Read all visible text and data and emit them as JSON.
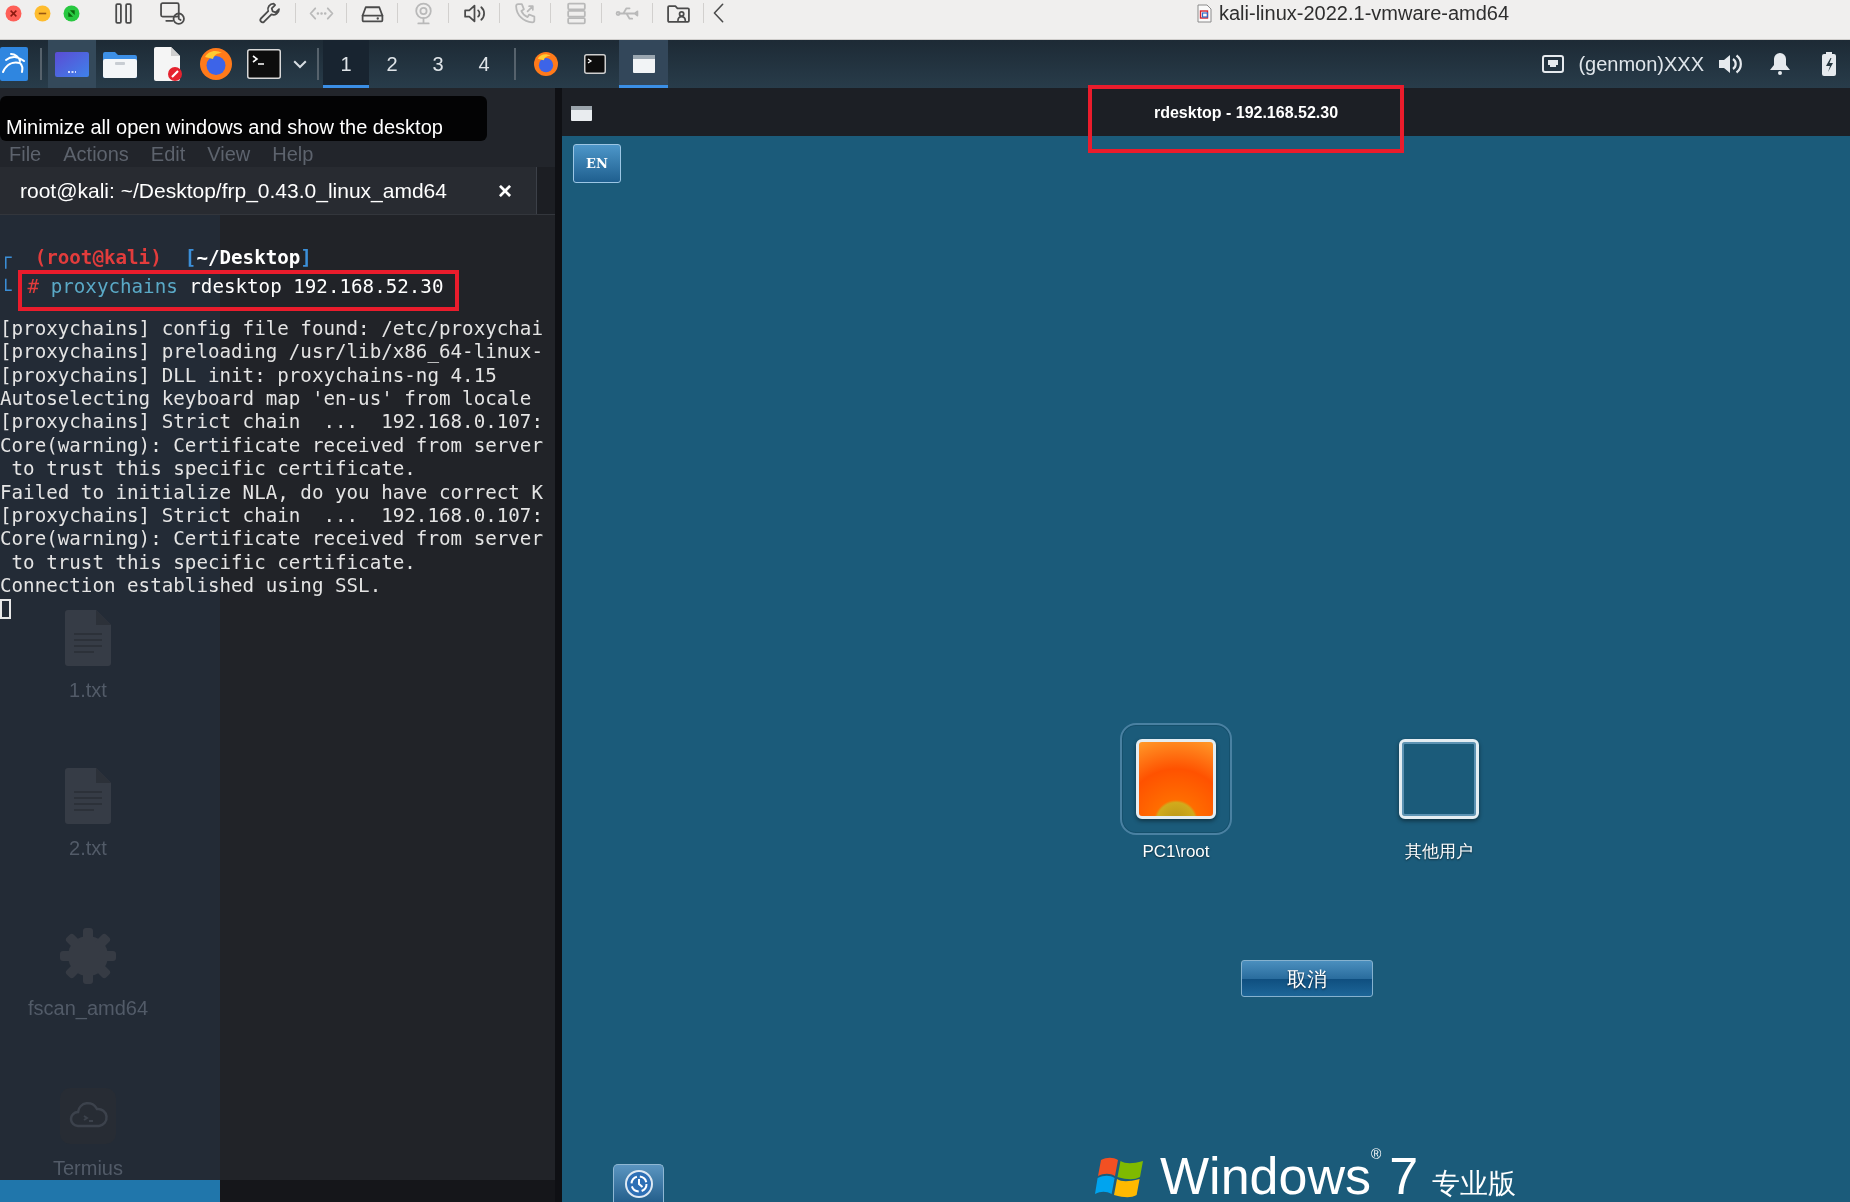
{
  "host_window": {
    "title": "kali-linux-2022.1-vmware-amd64",
    "toolbar": [
      {
        "kind": "pause",
        "disabled": false
      },
      {
        "kind": "snapshot",
        "disabled": false
      },
      {
        "kind": "settings",
        "disabled": false
      },
      {
        "kind": "network",
        "disabled": true
      },
      {
        "kind": "disk",
        "disabled": false
      },
      {
        "kind": "camera",
        "disabled": true
      },
      {
        "kind": "sound",
        "disabled": false
      },
      {
        "kind": "phone",
        "disabled": true
      },
      {
        "kind": "storage",
        "disabled": true
      },
      {
        "kind": "usb",
        "disabled": true
      },
      {
        "kind": "shared-folder",
        "disabled": false
      },
      {
        "kind": "collapse",
        "disabled": false
      }
    ]
  },
  "panel": {
    "launchers": [
      {
        "kind": "kali-menu",
        "hovered": false
      },
      {
        "kind": "show-desktop",
        "hovered": true
      },
      {
        "kind": "file-manager",
        "hovered": false
      },
      {
        "kind": "text-editor",
        "hovered": false
      },
      {
        "kind": "browser",
        "hovered": false
      },
      {
        "kind": "terminal",
        "hovered": false
      },
      {
        "kind": "dropdown",
        "hovered": false
      }
    ],
    "workspaces": [
      {
        "label": "1",
        "selected": true
      },
      {
        "label": "2",
        "selected": false
      },
      {
        "label": "3",
        "selected": false
      },
      {
        "label": "4",
        "selected": false
      }
    ],
    "tasks": [
      {
        "kind": "browser",
        "selected": false
      },
      {
        "kind": "terminal",
        "selected": false
      },
      {
        "kind": "window",
        "selected": true
      }
    ],
    "tray": [
      {
        "kind": "network"
      },
      {
        "kind": "text",
        "label": "(genmon)XXX"
      },
      {
        "kind": "volume"
      },
      {
        "kind": "notifications"
      },
      {
        "kind": "battery"
      }
    ]
  },
  "tooltip": {
    "text": "Minimize all open windows and show the desktop"
  },
  "desktop_icons": [
    {
      "kind": "text-file",
      "label": "1.txt"
    },
    {
      "kind": "text-file",
      "label": "2.txt"
    },
    {
      "kind": "executable",
      "label": "fscan_amd64"
    },
    {
      "kind": "app",
      "label": "Termius"
    }
  ],
  "terminal": {
    "menu": [
      "File",
      "Actions",
      "Edit",
      "View",
      "Help"
    ],
    "tab": {
      "title": "root@kali: ~/Desktop/frp_0.43.0_linux_amd64",
      "close": "×"
    },
    "prompt": {
      "corner": "┌",
      "user": "(root@kali)",
      "dir": "[**~/Desktop**]"
    },
    "command": {
      "corner": "└",
      "symbol": "#",
      "program": "proxychains",
      "args": "rdesktop 192.168.52.30",
      "highlighted": true
    },
    "output": [
      "[proxychains] config file found: /etc/proxychai",
      "[proxychains] preloading /usr/lib/x86_64-linux-",
      "[proxychains] DLL init: proxychains-ng 4.15",
      "Autoselecting keyboard map 'en-us' from locale",
      "[proxychains] Strict chain  ...  192.168.0.107:",
      "Core(warning): Certificate received from server",
      " to trust this specific certificate.",
      "Failed to initialize NLA, do you have correct K",
      "[proxychains] Strict chain  ...  192.168.0.107:",
      "Core(warning): Certificate received from server",
      " to trust this specific certificate.",
      "Connection established using SSL."
    ],
    "cursor": true
  },
  "rdesktop": {
    "title": "rdesktop - 192.168.52.30",
    "title_highlighted": true,
    "keyboard": "EN",
    "users": [
      {
        "name": "PC1\\root",
        "kind": "photo",
        "selected": true
      },
      {
        "name": "其他用户",
        "kind": "blank",
        "selected": false
      }
    ],
    "cancel": "取消",
    "brand": {
      "name": "Windows$^{®}$",
      "version": "7",
      "edition": "专业版"
    }
  }
}
